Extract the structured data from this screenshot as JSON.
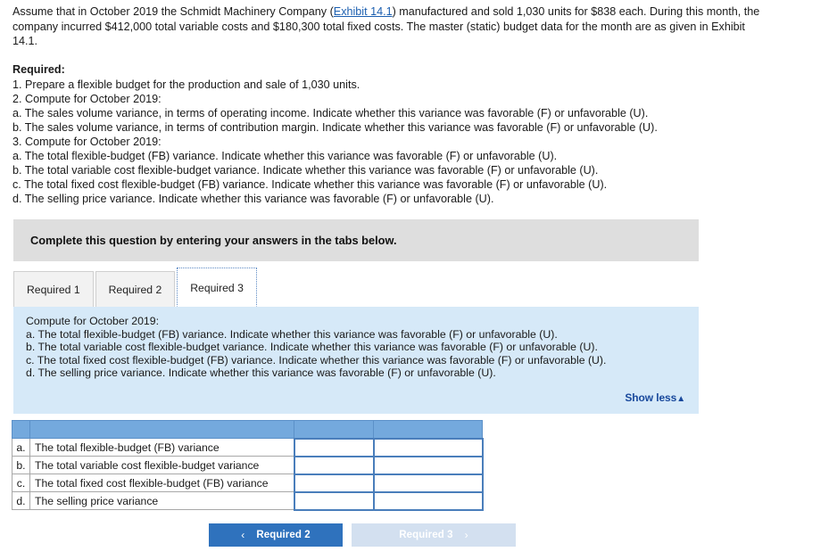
{
  "problem": {
    "text_before_link": "Assume that in October 2019 the Schmidt Machinery Company (",
    "link_label": "Exhibit 14.1",
    "text_after_link": ") manufactured and sold 1,030 units for $838 each. During this month, the company incurred $412,000 total variable costs and $180,300 total fixed costs. The master (static) budget data for the month are as given in Exhibit 14.1."
  },
  "required": {
    "title": "Required:",
    "lines": [
      "1. Prepare a flexible budget for the production and sale of 1,030 units.",
      "2. Compute for October 2019:",
      "a. The sales volume variance, in terms of operating income. Indicate whether this variance was favorable (F) or unfavorable (U).",
      "b. The sales volume variance, in terms of contribution margin. Indicate whether this variance was favorable (F) or unfavorable (U).",
      "3. Compute for October 2019:",
      "a. The total flexible-budget (FB) variance. Indicate whether this variance was favorable (F) or unfavorable (U).",
      "b. The total variable cost flexible-budget variance. Indicate whether this variance was favorable (F) or unfavorable (U).",
      "c. The total fixed cost flexible-budget (FB) variance. Indicate whether this variance was favorable (F) or unfavorable (U).",
      "d. The selling price variance. Indicate whether this variance was favorable (F) or unfavorable (U)."
    ]
  },
  "instruction_banner": {
    "text": "Complete this question by entering your answers in the tabs below."
  },
  "tabs": [
    {
      "label": "Required 1",
      "active": false
    },
    {
      "label": "Required 2",
      "active": false
    },
    {
      "label": "Required 3",
      "active": true
    }
  ],
  "info_panel": {
    "lines": [
      "Compute for October 2019:",
      "a. The total flexible-budget (FB) variance. Indicate whether this variance was favorable (F) or unfavorable (U).",
      "b. The total variable cost flexible-budget variance. Indicate whether this variance was favorable (F) or unfavorable (U).",
      "c. The total fixed cost flexible-budget (FB) variance. Indicate whether this variance was favorable (F) or unfavorable (U).",
      "d. The selling price variance. Indicate whether this variance was favorable (F) or unfavorable (U)."
    ],
    "show_less_label": "Show less",
    "show_less_caret": "▲"
  },
  "answer_table": {
    "header": [
      "",
      "",
      "",
      ""
    ],
    "rows": [
      {
        "letter": "a.",
        "label": "The total flexible-budget (FB) variance",
        "amount": "",
        "fu": ""
      },
      {
        "letter": "b.",
        "label": "The total variable cost flexible-budget variance",
        "amount": "",
        "fu": ""
      },
      {
        "letter": "c.",
        "label": "The total fixed cost flexible-budget (FB) variance",
        "amount": "",
        "fu": ""
      },
      {
        "letter": "d.",
        "label": "The selling price variance",
        "amount": "",
        "fu": ""
      }
    ]
  },
  "nav": {
    "prev_label": "Required 2",
    "prev_chevron": "‹",
    "next_label": "Required 3",
    "next_chevron": "›"
  },
  "colors": {
    "accent_blue": "#2f72bd",
    "header_blue": "#74a9dd",
    "panel_blue": "#d6e9f8",
    "banner_gray": "#dedede",
    "link_blue": "#1c5fb0",
    "input_border": "#4a7ebb",
    "disabled_btn": "#d3e0f0"
  }
}
